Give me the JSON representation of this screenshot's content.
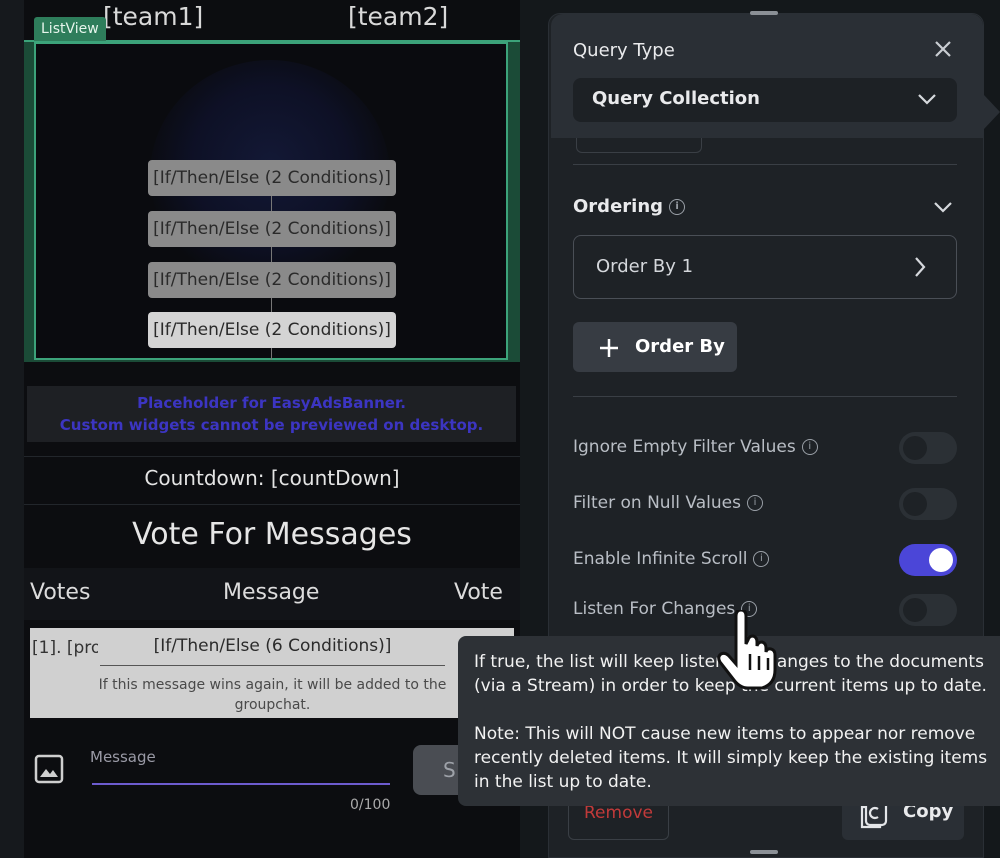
{
  "preview": {
    "team1": "[team1]",
    "team2": "[team2]",
    "listview_badge": "ListView",
    "conditions": [
      "[If/Then/Else (2 Conditions)]",
      "[If/Then/Else (2 Conditions)]",
      "[If/Then/Else (2 Conditions)]",
      "[If/Then/Else (2 Conditions)]"
    ],
    "ads_line1": "Placeholder for EasyAdsBanner.",
    "ads_line2": "Custom widgets cannot be previewed on desktop.",
    "countdown": "Countdown: [countDown]",
    "vote_title": "Vote For Messages",
    "columns": {
      "votes": "Votes",
      "message": "Message",
      "vote": "Vote"
    },
    "row": {
      "rank": "[1]. [prop",
      "condition": "[If/Then/Else (6 Conditions)]",
      "note": "If this message wins again, it will be added to the groupchat."
    },
    "message_label": "Message",
    "counter": "0/100",
    "send_label": "S"
  },
  "panel": {
    "query_type_label": "Query Type",
    "query_type_value": "Query Collection",
    "ordering_label": "Ordering",
    "order_by_item": "Order By 1",
    "add_order_by": "Order By",
    "toggles": [
      {
        "label": "Ignore Empty Filter Values",
        "on": false
      },
      {
        "label": "Filter on Null Values",
        "on": false
      },
      {
        "label": "Enable Infinite Scroll",
        "on": true
      },
      {
        "label": "Listen For Changes",
        "on": false
      }
    ],
    "remove_label": "Remove",
    "copy_label": "Copy"
  },
  "tooltip": {
    "para1": "If true, the list will keep listen       changes to the documents (via a Stream) in order to keep the current items up to date.",
    "para2": "Note: This will NOT cause new items to appear nor remove recently deleted items. It will simply keep the existing items in the list up to date."
  },
  "colors": {
    "accent": "#4b46d8",
    "listview_green": "#3ca37a",
    "ads_text": "#3c35c2",
    "remove_red": "#c23a3a"
  },
  "icons": [
    "close-icon",
    "chevron-down-icon",
    "info-icon",
    "chevron-right-icon",
    "plus-icon",
    "image-icon",
    "copy-icon",
    "hand-cursor-icon"
  ]
}
